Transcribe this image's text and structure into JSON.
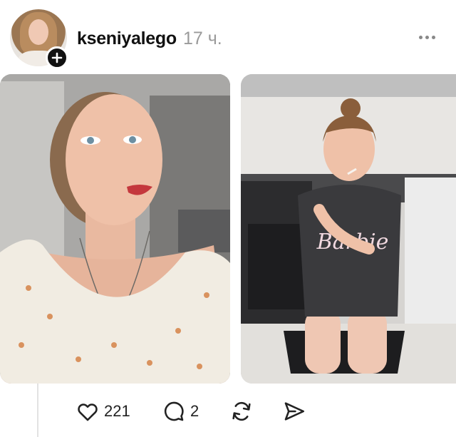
{
  "post": {
    "username": "kseniyalego",
    "time": "17 ч.",
    "avatar_icon": "avatar-photo",
    "add_icon": "plus-icon",
    "more_icon": "more-dots-icon"
  },
  "actions": {
    "likes": "221",
    "comments": "2",
    "like_icon": "heart-icon",
    "comment_icon": "speech-bubble-icon",
    "repost_icon": "repost-icon",
    "share_icon": "send-icon"
  },
  "photo2_text": "Barbie"
}
